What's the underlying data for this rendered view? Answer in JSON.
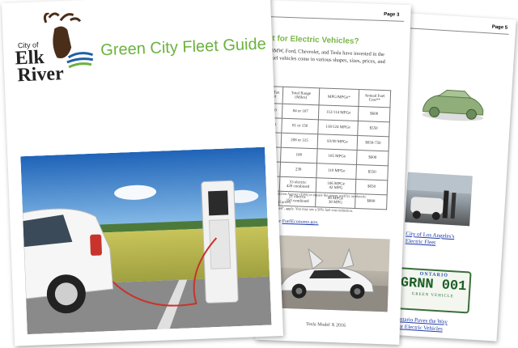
{
  "cover": {
    "logo_city_of": "City of",
    "logo_line1": "Elk",
    "logo_line2": "River",
    "title": "Green City Fleet Guide"
  },
  "middle_page": {
    "page_label": "Page 3",
    "heading": "t for Electric Vehicles?",
    "intro_line1": "BMW, Ford, Chevrolet, and Tesla have invested in the",
    "intro_line2": "fuel vehicles come in various shapes, sizes, prices, and",
    "table": {
      "headers": [
        "e Tax\nit",
        "Total Range\n(Miles)",
        "MPG/MPGe*",
        "Annual Fuel\nCost**"
      ],
      "rows": [
        [
          "10",
          "84 or 107",
          "112/114 MPGe",
          "$600"
        ],
        [
          "00",
          "81 or 150",
          "118/124 MPGe",
          "$550"
        ],
        [
          "00",
          "208 or 315",
          "93/99 MPGe",
          "$650-750"
        ],
        [
          "00",
          "100",
          "105 MPGe",
          "$600"
        ],
        [
          "0",
          "238",
          "119 MPGe",
          "$550"
        ],
        [
          "0",
          "53 electric\n420 combined",
          "106 MPGe\n42 MPG",
          "$650"
        ],
        [
          "0",
          "21 electric\n350 combined",
          "98 MPGe\n38 MPG",
          "$800"
        ]
      ]
    },
    "note1": "Protection Agency (EPA) to equate the power used by an electric",
    "note2": "nt fuel prices.",
    "note3": "on used\", apply. You may see a 50% fuel cost reduction.",
    "link_prefix": "V",
    "link_or": "or",
    "link_fueleconomy": "FuelEconomy.gov.",
    "photo_caption": "Tesla Model X 2016"
  },
  "back_page": {
    "page_label": "Page 5",
    "caption1_line1": "City of Los Angeles's",
    "caption1_line2": "Electric Fleet",
    "plate_province": "ONTARIO",
    "plate_number": "GRNN 001",
    "plate_slogan": "GREEN VEHICLE",
    "caption2_line1": "Ontario Paves the Way",
    "caption2_line2": "For Electric Vehicles"
  }
}
